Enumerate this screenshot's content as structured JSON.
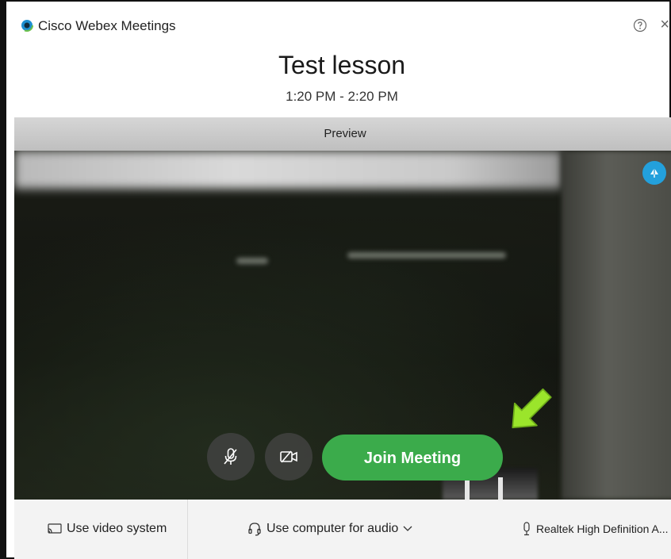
{
  "window": {
    "title": "Cisco Webex Meetings",
    "close_glyph": "×"
  },
  "meeting": {
    "title": "Test lesson",
    "time": "1:20 PM - 2:20 PM"
  },
  "preview": {
    "label": "Preview"
  },
  "controls": {
    "join_label": "Join Meeting",
    "mute_icon": "microphone-muted-icon",
    "video_icon": "video-off-icon"
  },
  "footer": {
    "video_system_label": "Use video system",
    "audio_label": "Use computer for audio",
    "mic_device_label": "Realtek High Definition A..."
  },
  "colors": {
    "join_green": "#3bab4b",
    "accent_blue": "#23a0dc",
    "arrow_green": "#9be52b"
  }
}
